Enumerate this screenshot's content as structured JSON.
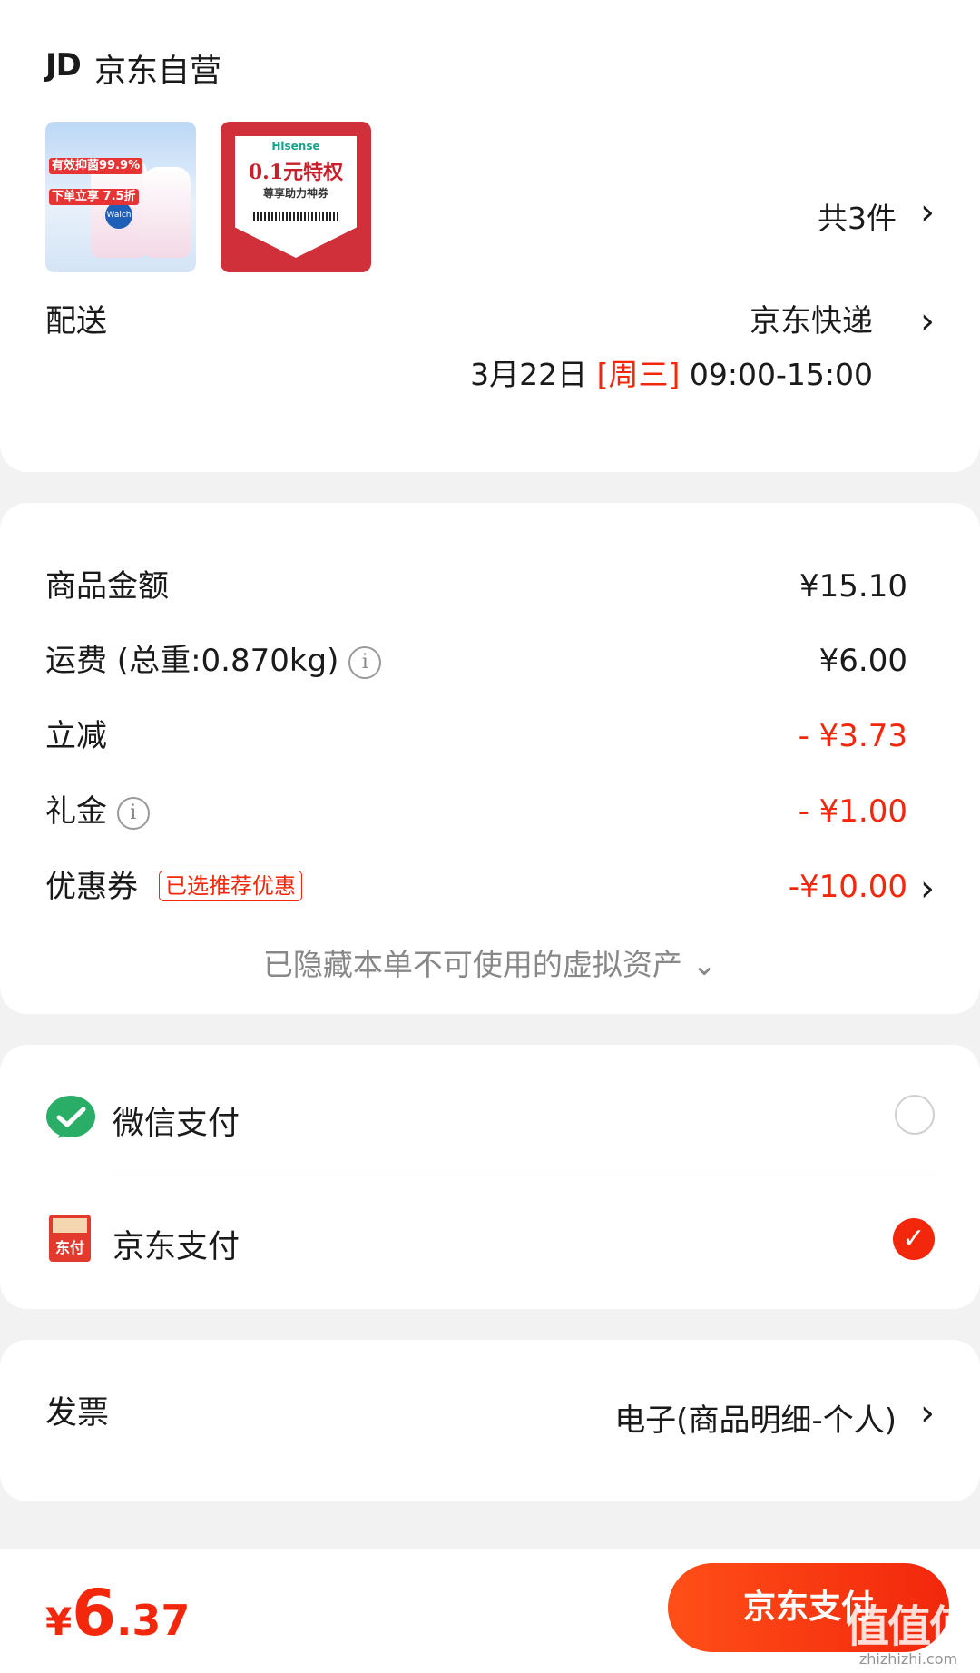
{
  "store": {
    "logo_text": "JD",
    "name": "京东自营",
    "thumb1": {
      "badges": [
        "有效抑菌99.9%",
        "下单立享 7.5折"
      ],
      "brand": "Walch"
    },
    "thumb2": {
      "brand": "Hisense",
      "title": "0.1元特权",
      "subtitle": "尊享助力神券"
    },
    "count": "共3件"
  },
  "delivery": {
    "label": "配送",
    "method": "京东快递",
    "date": "3月22日",
    "weekday": "[周三]",
    "window": "09:00-15:00"
  },
  "price": {
    "goods_label": "商品金额",
    "goods_value": "¥15.10",
    "freight_label": "运费 (总重:0.870kg)",
    "freight_value": "¥6.00",
    "discount_label": "立减",
    "discount_value": "- ¥3.73",
    "gift_label": "礼金",
    "gift_value": "- ¥1.00",
    "coupon_label": "优惠券",
    "coupon_tag": "已选推荐优惠",
    "coupon_value": "-¥10.00",
    "hidden_assets": "已隐藏本单不可使用的虚拟资产 ⌄",
    "info_glyph": "i"
  },
  "pay": {
    "wechat_label": "微信支付",
    "jdpay_label": "京东支付",
    "jdpay_icon_text": "东付",
    "check_glyph": "✓",
    "selected": "jdpay"
  },
  "invoice": {
    "label": "发票",
    "value": "电子(商品明细-个人)"
  },
  "footer": {
    "currency": "¥",
    "total_int": "6",
    "total_dec": ".37",
    "submit_label": "京东支付",
    "watermark": "值值值",
    "watermark_url": "zhizhizhi.com"
  },
  "icons": {
    "chevron": "›",
    "accent_color": "#f2270c",
    "wechat_color": "#2aae67"
  }
}
